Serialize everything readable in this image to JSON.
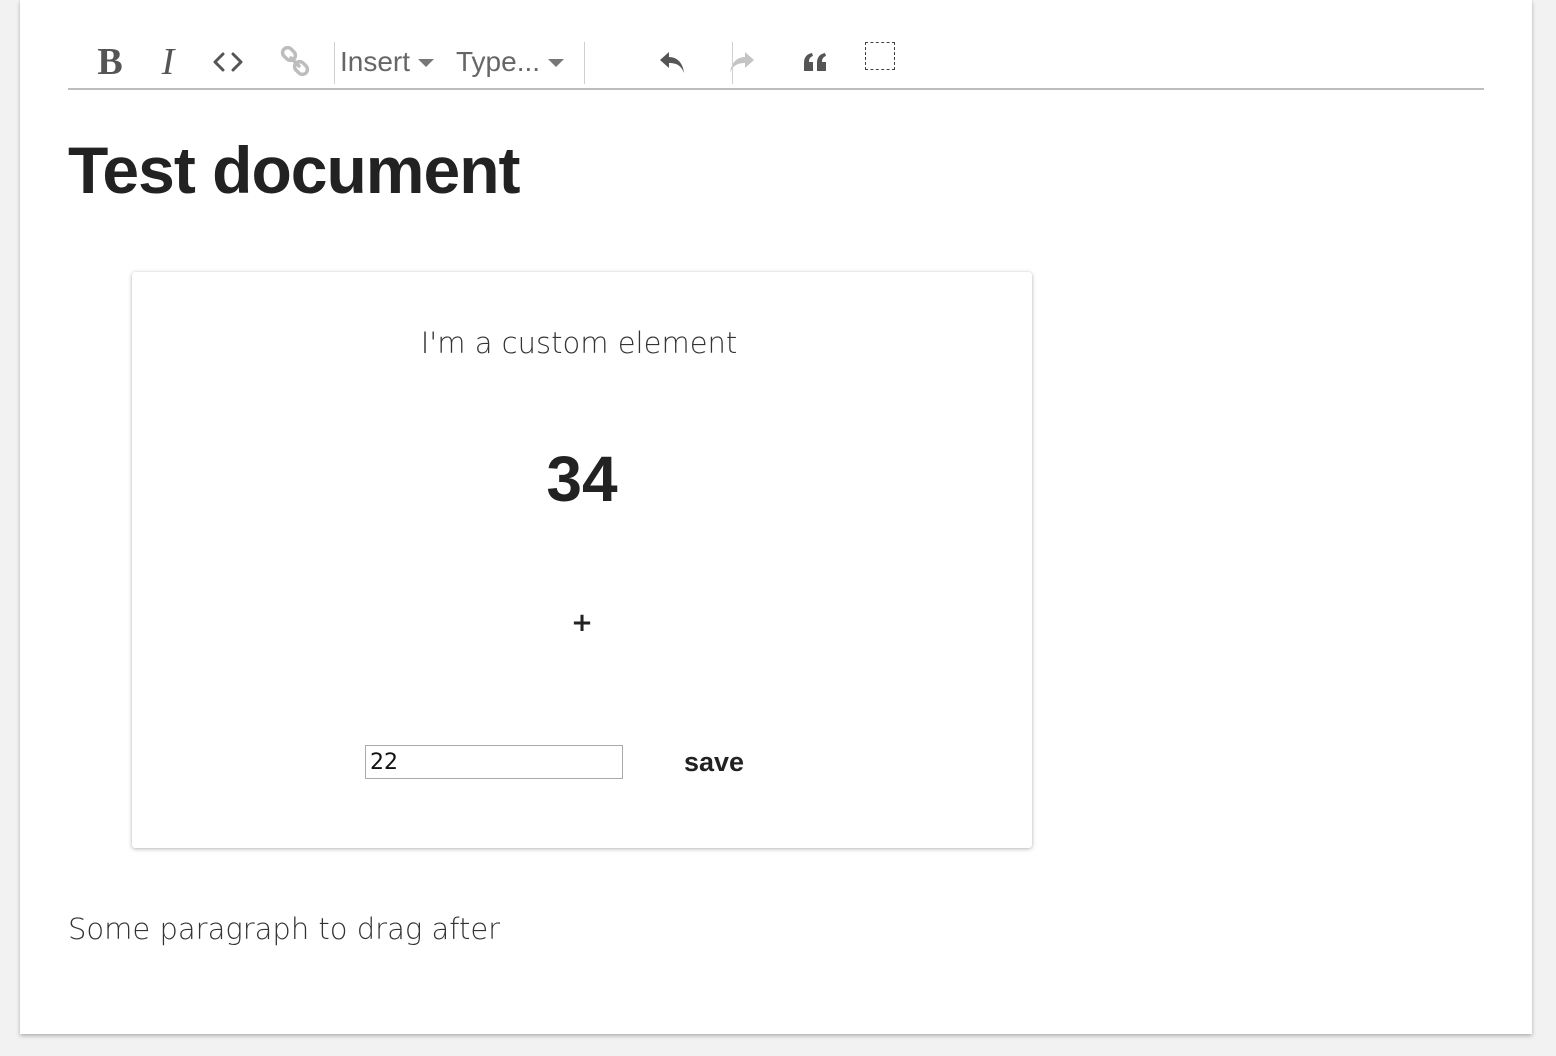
{
  "toolbar": {
    "bold_label": "B",
    "italic_label": "I",
    "insert_label": "Insert",
    "type_label": "Type...",
    "icons": [
      "bold-icon",
      "italic-icon",
      "code-icon",
      "link-icon",
      "undo-icon",
      "redo-icon",
      "blockquote-icon",
      "select-parent-icon"
    ]
  },
  "document": {
    "title": "Test document",
    "paragraph": "Some paragraph to drag after"
  },
  "custom_element": {
    "caption": "I'm a custom element",
    "count": "34",
    "increment_label": "+",
    "input_value": "22",
    "save_label": "save"
  }
}
